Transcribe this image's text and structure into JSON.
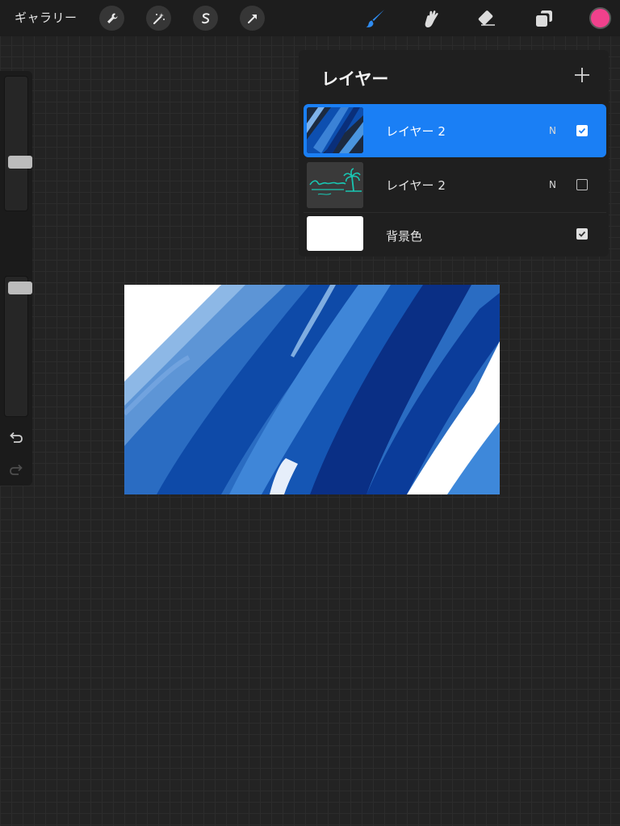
{
  "topbar": {
    "gallery_label": "ギャラリー",
    "left_tools": [
      "wrench-icon",
      "magic-wand-icon",
      "selection-icon",
      "transform-arrow-icon"
    ],
    "right_tools": [
      "brush-icon",
      "smudge-icon",
      "eraser-icon",
      "layers-icon"
    ],
    "current_color": "#f0418c"
  },
  "sidebar": {
    "size_slider_value": 0.6,
    "opacity_slider_value": 1.0,
    "icons": [
      "modify-square-icon",
      "undo-icon",
      "redo-icon"
    ]
  },
  "layers_panel": {
    "title": "レイヤー",
    "add_icon": "plus-icon",
    "layers": [
      {
        "name": "レイヤー 2",
        "blend_mode": "N",
        "visible": true,
        "selected": true,
        "thumbnail": "blue-brush-strokes"
      },
      {
        "name": "レイヤー 2",
        "blend_mode": "N",
        "visible": false,
        "selected": false,
        "thumbnail": "teal-palm-logo"
      },
      {
        "name": "背景色",
        "blend_mode": "",
        "visible": true,
        "selected": false,
        "thumbnail": "white-fill"
      }
    ]
  },
  "colors": {
    "accent": "#1a7ff5",
    "brush_icon": "#2f8cf0",
    "logo_teal": "#19c6b2"
  }
}
